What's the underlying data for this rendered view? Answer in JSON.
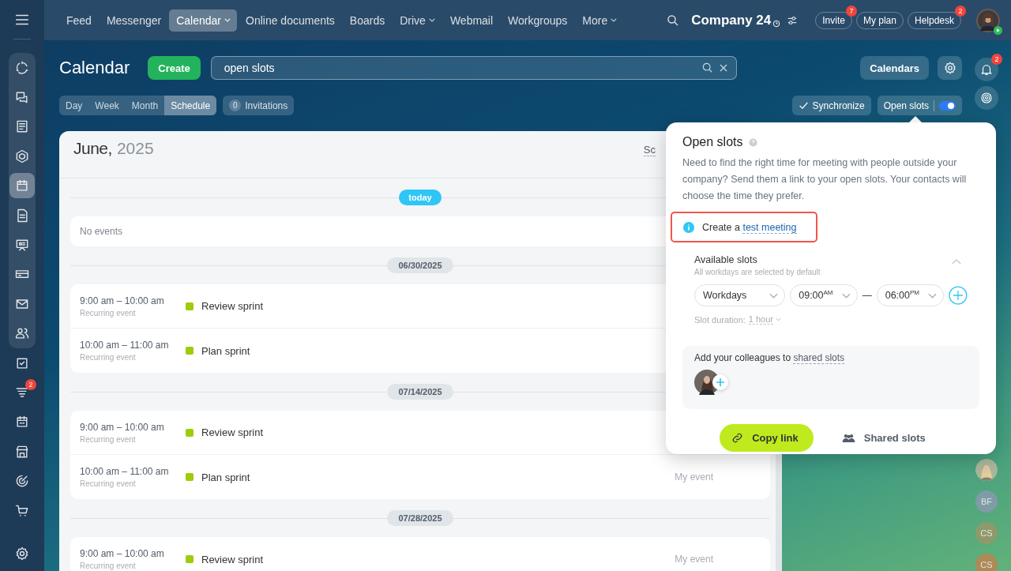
{
  "sidebar": {
    "group_items": [
      {
        "selected": false
      },
      {
        "selected": false
      },
      {
        "selected": false
      },
      {
        "selected": false
      },
      {
        "selected": true
      },
      {
        "selected": false
      },
      {
        "selected": false
      },
      {
        "selected": false
      },
      {
        "selected": false
      },
      {
        "selected": false
      }
    ],
    "items": [
      {
        "selected": false
      },
      {
        "selected": false,
        "badge": "2"
      },
      {
        "selected": false
      },
      {
        "selected": false
      },
      {
        "selected": false
      },
      {
        "selected": false
      }
    ]
  },
  "top_nav": {
    "items": [
      {
        "label": "Feed",
        "selected": false,
        "dropdown": false
      },
      {
        "label": "Messenger",
        "selected": false,
        "dropdown": false
      },
      {
        "label": "Calendar",
        "selected": true,
        "dropdown": true
      },
      {
        "label": "Online documents",
        "selected": false,
        "dropdown": false
      },
      {
        "label": "Boards",
        "selected": false,
        "dropdown": false
      },
      {
        "label": "Drive",
        "selected": false,
        "dropdown": true
      },
      {
        "label": "Webmail",
        "selected": false,
        "dropdown": false
      },
      {
        "label": "Workgroups",
        "selected": false,
        "dropdown": false
      },
      {
        "label": "More",
        "selected": false,
        "dropdown": true
      }
    ]
  },
  "header": {
    "brand": "Company 24",
    "buttons": [
      {
        "label": "Invite",
        "badge": "7"
      },
      {
        "label": "My plan"
      },
      {
        "label": "Helpdesk",
        "badge": "2"
      }
    ]
  },
  "toolbar": {
    "title": "Calendar",
    "create": "Create",
    "search": {
      "value": "open slots"
    },
    "calendars": "Calendars",
    "views": [
      {
        "label": "Day",
        "selected": false
      },
      {
        "label": "Week",
        "selected": false
      },
      {
        "label": "Month",
        "selected": false
      },
      {
        "label": "Schedule",
        "selected": true
      }
    ],
    "invitations": {
      "count": "0",
      "label": "Invitations"
    },
    "synchronize": "Synchronize",
    "open_slots": {
      "label": "Open slots",
      "on": true
    }
  },
  "right_rail": {
    "notifications_badge": "2",
    "contacts": [
      {
        "kind": "picture"
      },
      {
        "kind": "initials",
        "initials": "BF",
        "color": "#7f9ba6"
      },
      {
        "kind": "initials",
        "initials": "CS",
        "color": "#8f9a6c"
      },
      {
        "kind": "initials",
        "initials": "CS",
        "color": "#ad8a58"
      }
    ]
  },
  "schedule": {
    "month": "June,",
    "year": "2025",
    "cut_label": "Sc",
    "sections": [
      {
        "kind": "today",
        "label": "today",
        "empty_text": "No events"
      },
      {
        "kind": "date",
        "label": "06/30/2025",
        "events": [
          {
            "time": "9:00 am – 10:00 am",
            "note": "Recurring event",
            "title": "Review sprint",
            "color": "#9dcc0a"
          },
          {
            "time": "10:00 am – 11:00 am",
            "note": "Recurring event",
            "title": "Plan sprint",
            "color": "#9dcc0a"
          }
        ]
      },
      {
        "kind": "date",
        "label": "07/14/2025",
        "events": [
          {
            "time": "9:00 am – 10:00 am",
            "note": "Recurring event",
            "title": "Review sprint",
            "color": "#9dcc0a"
          },
          {
            "time": "10:00 am – 11:00 am",
            "note": "Recurring event",
            "title": "Plan sprint",
            "color": "#9dcc0a",
            "owner": "My event"
          }
        ]
      },
      {
        "kind": "date",
        "label": "07/28/2025",
        "events": [
          {
            "time": "9:00 am – 10:00 am",
            "note": "Recurring event",
            "title": "Review sprint",
            "color": "#9dcc0a",
            "owner": "My event"
          }
        ]
      }
    ]
  },
  "popup": {
    "title": "Open slots",
    "description": "Need to find the right time for meeting with people outside your company? Send them a link to your open slots. Your contacts will choose the time they prefer.",
    "tip": {
      "text": "Create a",
      "link": "test meeting",
      "highlighted": true
    },
    "available": {
      "title": "Available slots",
      "subtitle": "All workdays are selected by default",
      "expanded": true,
      "days": "Workdays",
      "from": "09:00$^{AM}$",
      "separator": "—",
      "to": "06:00$^{PM}$",
      "duration_label": "Slot duration:",
      "duration": "1 hour"
    },
    "colleagues": {
      "text": "Add your colleagues to",
      "link": "shared slots"
    },
    "copy_link": "Copy link",
    "shared_slots": "Shared slots"
  }
}
